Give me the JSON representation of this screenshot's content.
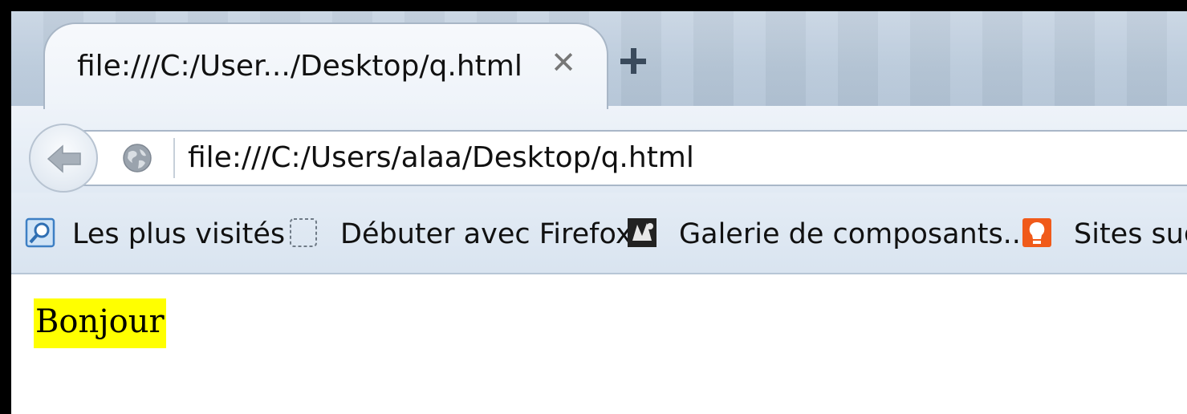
{
  "tab": {
    "title": "file:///C:/User.../Desktop/q.html",
    "close_glyph": "✕"
  },
  "toolbar": {
    "url": "file:///C:/Users/alaa/Desktop/q.html"
  },
  "bookmarks": [
    {
      "label": "Les plus visités",
      "icon": "search-bookmark-icon"
    },
    {
      "label": "Débuter avec Firefox",
      "icon": "dashed-page-icon"
    },
    {
      "label": "Galerie de composants...",
      "icon": "gallery-icon"
    },
    {
      "label": "Sites sug",
      "icon": "lightbulb-icon"
    }
  ],
  "page": {
    "text": "Bonjour",
    "highlight_color": "#ffff00"
  },
  "colors": {
    "window_frame": "#000000",
    "tabstrip": "#b9c9da",
    "toolbar": "#e1eaf4"
  }
}
